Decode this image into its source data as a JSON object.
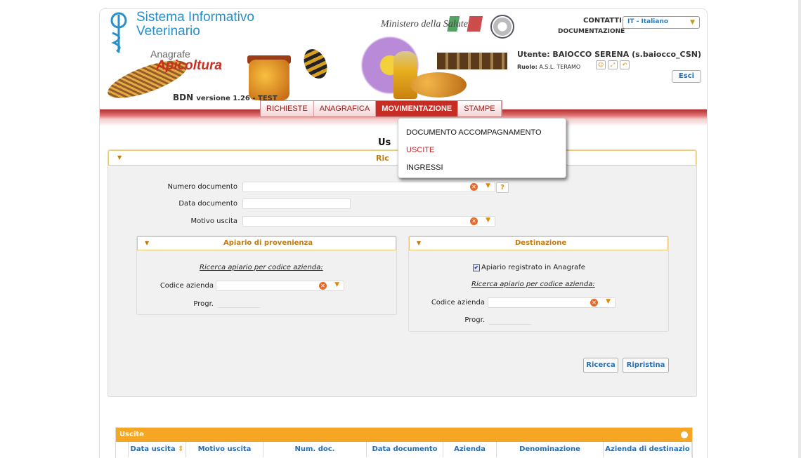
{
  "header": {
    "system_title_line1": "Sistema Informativo",
    "system_title_line2": "Veterinario",
    "app_subtitle_small": "Anagrafe",
    "app_subtitle_big": "Apicoltura",
    "version_prefix": "BDN",
    "version_text": "versione 1.26  - TEST",
    "ministry_text": "Ministero della Salute",
    "contatti": "CONTATTI",
    "documentazione": "DOCUMENTAZIONE",
    "language": "IT - Italiano",
    "user_label": "Utente: BAIOCCO SERENA (s.baiocco_CSN)",
    "role_label": "Ruolo:",
    "role_value": "A.S.L. TERAMO",
    "logout": "Esci"
  },
  "menu": {
    "items": [
      {
        "label": "RICHIESTE"
      },
      {
        "label": "ANAGRAFICA"
      },
      {
        "label": "MOVIMENTAZIONE"
      },
      {
        "label": "STAMPE"
      }
    ],
    "active": "MOVIMENTAZIONE",
    "dropdown": [
      {
        "label": "DOCUMENTO ACCOMPAGNAMENTO"
      },
      {
        "label": "USCITE"
      },
      {
        "label": "INGRESSI"
      }
    ]
  },
  "page": {
    "title_visible": "Us",
    "panel_title_visible": "Ric"
  },
  "search_form": {
    "numero_documento_label": "Numero documento",
    "help": "?",
    "data_documento_label": "Data documento",
    "motivo_uscita_label": "Motivo uscita",
    "provenienza": {
      "title": "Apiario di provenienza",
      "link": "Ricerca apiario per codice azienda:",
      "codice_label": "Codice azienda",
      "progr_label": "Progr."
    },
    "destinazione": {
      "title": "Destinazione",
      "checkbox_label": "Apiario registrato in Anagrafe",
      "checkbox_checked": true,
      "link": "Ricerca apiario per codice azienda:",
      "codice_label": "Codice azienda",
      "progr_label": "Progr."
    },
    "search_button": "Ricerca",
    "reset_button": "Ripristina"
  },
  "results": {
    "title": "Uscite",
    "columns": [
      "Data uscita",
      "Motivo uscita",
      "Num. doc.",
      "Data documento",
      "Azienda",
      "Denominazione",
      "Azienda di destinazio"
    ]
  },
  "colors": {
    "accent_red": "#c62c24",
    "panel_orange": "#c07a10",
    "grid_orange": "#f5a623",
    "link_blue": "#2a6db0"
  }
}
